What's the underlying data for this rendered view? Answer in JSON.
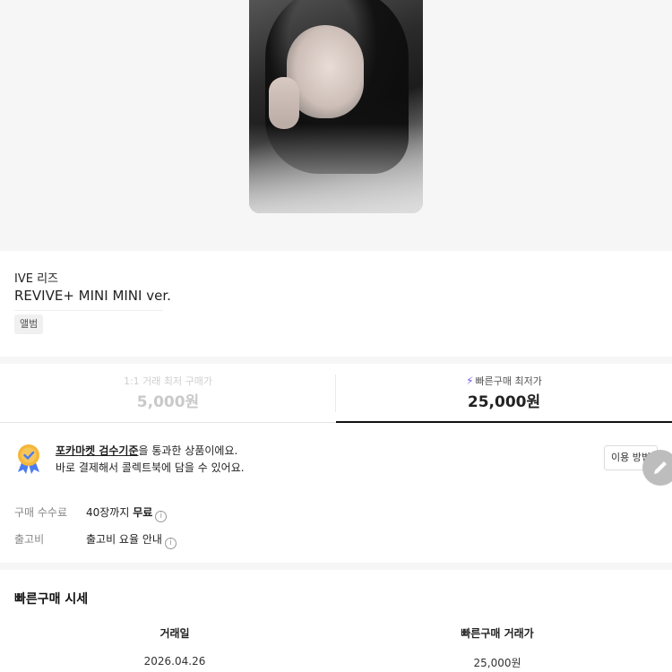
{
  "product": {
    "artist": "IVE 리즈",
    "album": "REVIVE+ MINI MINI ver.",
    "tag": "앨범"
  },
  "price_tabs": [
    {
      "label": "1:1 거래 최저 구매가",
      "price": "5,000원",
      "active": false
    },
    {
      "label": "빠른구매 최저가",
      "price": "25,000원",
      "active": true,
      "icon": "bolt-icon"
    }
  ],
  "inspection": {
    "link_text": "포카마켓 검수기준",
    "line1_rest": "을 통과한 상품이에요.",
    "line2": "바로 결제해서 콜렉트북에 담을 수 있어요.",
    "button_label": "이용 방법",
    "icon": "ribbon-badge-icon"
  },
  "fees": [
    {
      "key": "구매 수수료",
      "value_prefix": "40장까지 ",
      "value_bold": "무료"
    },
    {
      "key": "출고비",
      "value_prefix": "출고비 요율 안내",
      "value_bold": ""
    }
  ],
  "history": {
    "title": "빠른구매 시세",
    "columns": [
      "거래일",
      "빠른구매 거래가"
    ],
    "rows": [
      [
        "2026.04.26",
        "25,000원"
      ]
    ]
  },
  "colors": {
    "accent": "#6b5cf6",
    "badge_gold": "#f4b73b",
    "badge_blue": "#4a7cf0"
  }
}
